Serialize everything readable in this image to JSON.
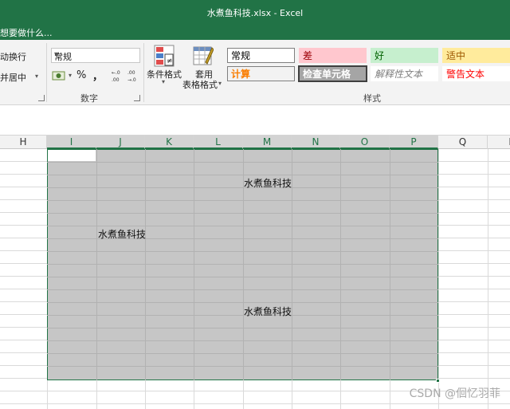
{
  "window": {
    "title": "水煮鱼科技.xlsx - Excel"
  },
  "tell_me": {
    "placeholder": "想要做什么..."
  },
  "ribbon": {
    "alignment": {
      "wrap_text": "动换行",
      "merge_center": "并居中"
    },
    "number": {
      "format_value": "常规",
      "percent": "%",
      "comma": "，",
      "increase_decimal": ".0\n.00",
      "decrease_decimal": ".00\n.0",
      "group_label": "数字"
    },
    "conditional_format": {
      "label": "条件格式"
    },
    "format_as_table": {
      "label_line1": "套用",
      "label_line2": "表格格式"
    },
    "styles": {
      "group_label": "样式",
      "cells": [
        {
          "name": "normal",
          "label": "常规",
          "bg": "#ffffff",
          "color": "#000000",
          "border": "#7f7f7f"
        },
        {
          "name": "bad",
          "label": "差",
          "bg": "#ffc7ce",
          "color": "#9c0006",
          "border": "#ffc7ce"
        },
        {
          "name": "good",
          "label": "好",
          "bg": "#c6efce",
          "color": "#006100",
          "border": "#c6efce"
        },
        {
          "name": "neutral",
          "label": "适中",
          "bg": "#ffeb9c",
          "color": "#9c5700",
          "border": "#ffeb9c"
        },
        {
          "name": "calculation",
          "label": "计算",
          "bg": "#f2f2f2",
          "color": "#fa7d00",
          "border": "#7f7f7f"
        },
        {
          "name": "check-cell",
          "label": "检查单元格",
          "bg": "#a5a5a5",
          "color": "#ffffff",
          "border": "#3f3f3f"
        },
        {
          "name": "explanatory",
          "label": "解释性文本",
          "bg": "#ffffff",
          "color": "#7f7f7f",
          "border": "#ffffff"
        },
        {
          "name": "warning",
          "label": "警告文本",
          "bg": "#ffffff",
          "color": "#ff0000",
          "border": "#ffffff"
        }
      ]
    }
  },
  "columns": [
    "H",
    "I",
    "J",
    "K",
    "L",
    "M",
    "N",
    "O",
    "P",
    "Q",
    "R"
  ],
  "cells": [
    {
      "text": "水煮鱼科技",
      "ref": "M3"
    },
    {
      "text": "水煮鱼科技",
      "ref": "J7"
    },
    {
      "text": "水煮鱼科技",
      "ref": "M13"
    }
  ],
  "watermark": "CSDN @佪忆羽菲",
  "colors": {
    "accent": "#217346",
    "selection_fill": "#c6c6c6"
  }
}
